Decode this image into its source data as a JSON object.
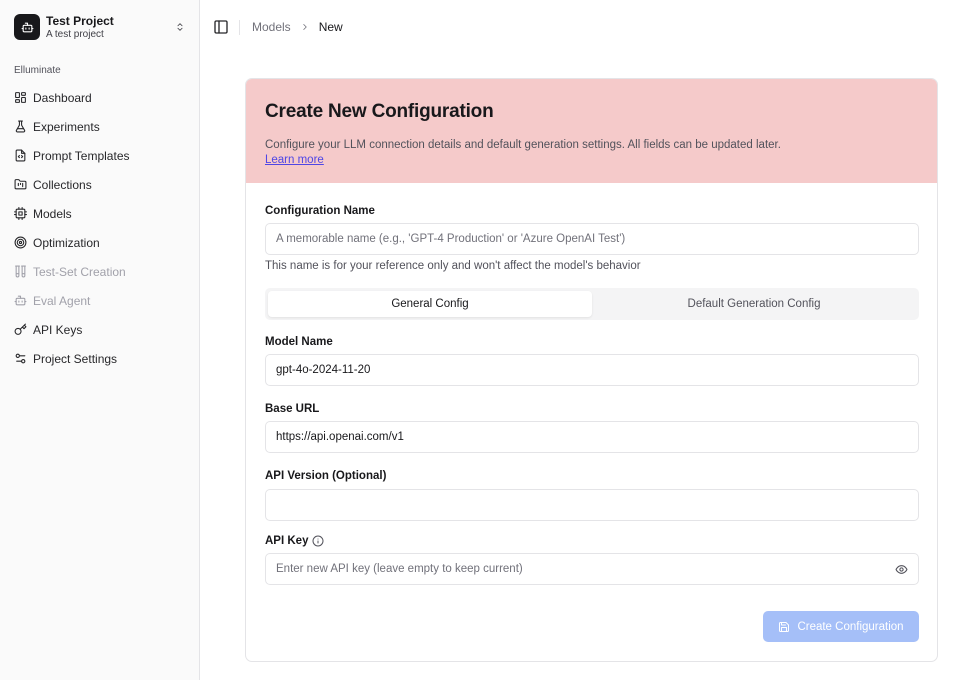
{
  "project": {
    "name": "Test Project",
    "description": "A test project"
  },
  "sidebar": {
    "group_label": "Elluminate",
    "items": [
      {
        "label": "Dashboard",
        "icon": "dashboard-icon",
        "disabled": false
      },
      {
        "label": "Experiments",
        "icon": "flask-icon",
        "disabled": false
      },
      {
        "label": "Prompt Templates",
        "icon": "file-code-icon",
        "disabled": false
      },
      {
        "label": "Collections",
        "icon": "folder-icon",
        "disabled": false
      },
      {
        "label": "Models",
        "icon": "bot-icon",
        "disabled": false
      },
      {
        "label": "Optimization",
        "icon": "target-icon",
        "disabled": false
      },
      {
        "label": "Test-Set Creation",
        "icon": "test-tubes-icon",
        "disabled": true
      },
      {
        "label": "Eval Agent",
        "icon": "bot-icon",
        "disabled": true
      },
      {
        "label": "API Keys",
        "icon": "key-icon",
        "disabled": false
      },
      {
        "label": "Project Settings",
        "icon": "settings-icon",
        "disabled": false
      }
    ]
  },
  "breadcrumb": {
    "parent": "Models",
    "current": "New"
  },
  "form": {
    "title": "Create New Configuration",
    "description": "Configure your LLM connection details and default generation settings. All fields can be updated later.",
    "learn_more": "Learn more",
    "config_name": {
      "label": "Configuration Name",
      "placeholder": "A memorable name (e.g., 'GPT-4 Production' or 'Azure OpenAI Test')",
      "value": "",
      "help": "This name is for your reference only and won't affect the model's behavior"
    },
    "tabs": [
      {
        "label": "General Config",
        "active": true
      },
      {
        "label": "Default Generation Config",
        "active": false
      }
    ],
    "model_name": {
      "label": "Model Name",
      "value": "gpt-4o-2024-11-20"
    },
    "base_url": {
      "label": "Base URL",
      "value": "https://api.openai.com/v1"
    },
    "api_version": {
      "label": "API Version (Optional)",
      "value": ""
    },
    "api_key": {
      "label": "API Key",
      "placeholder": "Enter new API key (leave empty to keep current)",
      "value": ""
    },
    "submit_label": "Create Configuration"
  },
  "colors": {
    "header_bg": "#f5caca",
    "submit_bg_disabled": "#a5bff8",
    "link": "#4f46e5"
  }
}
